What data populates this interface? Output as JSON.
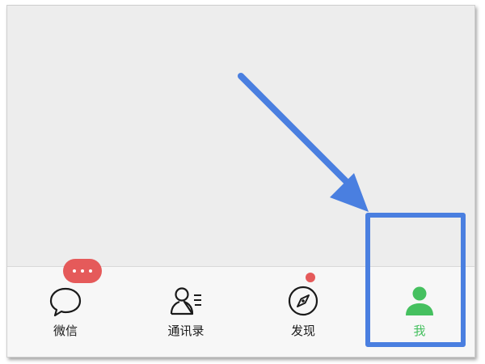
{
  "tabbar": {
    "tabs": [
      {
        "label": "微信",
        "icon": "chat-bubble-icon"
      },
      {
        "label": "通讯录",
        "icon": "contacts-icon"
      },
      {
        "label": "发现",
        "icon": "compass-icon"
      },
      {
        "label": "我",
        "icon": "person-icon",
        "active": true
      }
    ]
  },
  "badges": {
    "wechat": "more-dots-badge",
    "discover": "red-dot-badge"
  },
  "annotation": {
    "arrow": "blue-arrow-pointing-to-me-tab",
    "highlight": "blue-highlight-box"
  },
  "colors": {
    "active": "#45c05f",
    "badge": "#e55a5a",
    "annotation": "#4a7fe0",
    "tabbar_bg": "#f7f7f7",
    "content_bg": "#ededed"
  }
}
